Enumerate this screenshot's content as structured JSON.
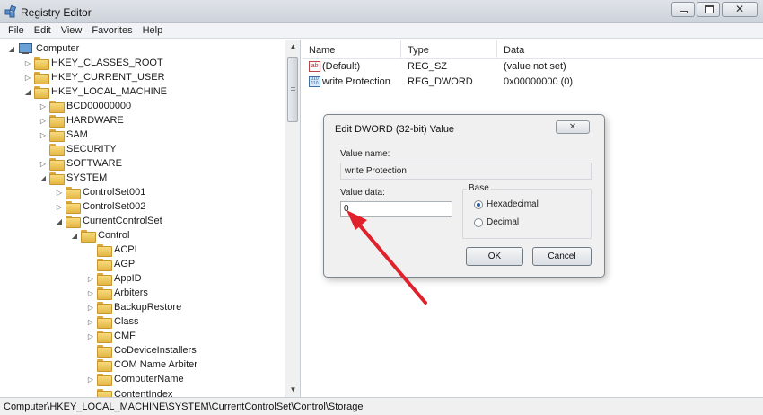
{
  "window": {
    "title": "Registry Editor",
    "controls": {
      "minimize": "minimize-icon",
      "maximize": "maximize-icon",
      "close": "✕"
    }
  },
  "menu": [
    "File",
    "Edit",
    "View",
    "Favorites",
    "Help"
  ],
  "tree": {
    "root": "Computer",
    "items": [
      "HKEY_CLASSES_ROOT",
      "HKEY_CURRENT_USER",
      "HKEY_LOCAL_MACHINE",
      "BCD00000000",
      "HARDWARE",
      "SAM",
      "SECURITY",
      "SOFTWARE",
      "SYSTEM",
      "ControlSet001",
      "ControlSet002",
      "CurrentControlSet",
      "Control",
      "ACPI",
      "AGP",
      "AppID",
      "Arbiters",
      "BackupRestore",
      "Class",
      "CMF",
      "CoDeviceInstallers",
      "COM Name Arbiter",
      "ComputerName",
      "ContentIndex"
    ]
  },
  "values_list": {
    "headers": {
      "name": "Name",
      "type": "Type",
      "data": "Data"
    },
    "rows": [
      {
        "name": "(Default)",
        "type": "REG_SZ",
        "data": "(value not set)",
        "icon": "string-value-icon"
      },
      {
        "name": "write Protection",
        "type": "REG_DWORD",
        "data": "0x00000000 (0)",
        "icon": "binary-value-icon"
      }
    ]
  },
  "dialog": {
    "title": "Edit DWORD (32-bit) Value",
    "value_name_label": "Value name:",
    "value_name": "write Protection",
    "value_data_label": "Value data:",
    "value_data": "0",
    "base_label": "Base",
    "base_options": [
      "Hexadecimal",
      "Decimal"
    ],
    "base_selected": "Hexadecimal",
    "ok_label": "OK",
    "cancel_label": "Cancel"
  },
  "status_bar": "Computer\\HKEY_LOCAL_MACHINE\\SYSTEM\\CurrentControlSet\\Control\\Storage",
  "annotation": {
    "arrow_color": "#e0202a"
  }
}
